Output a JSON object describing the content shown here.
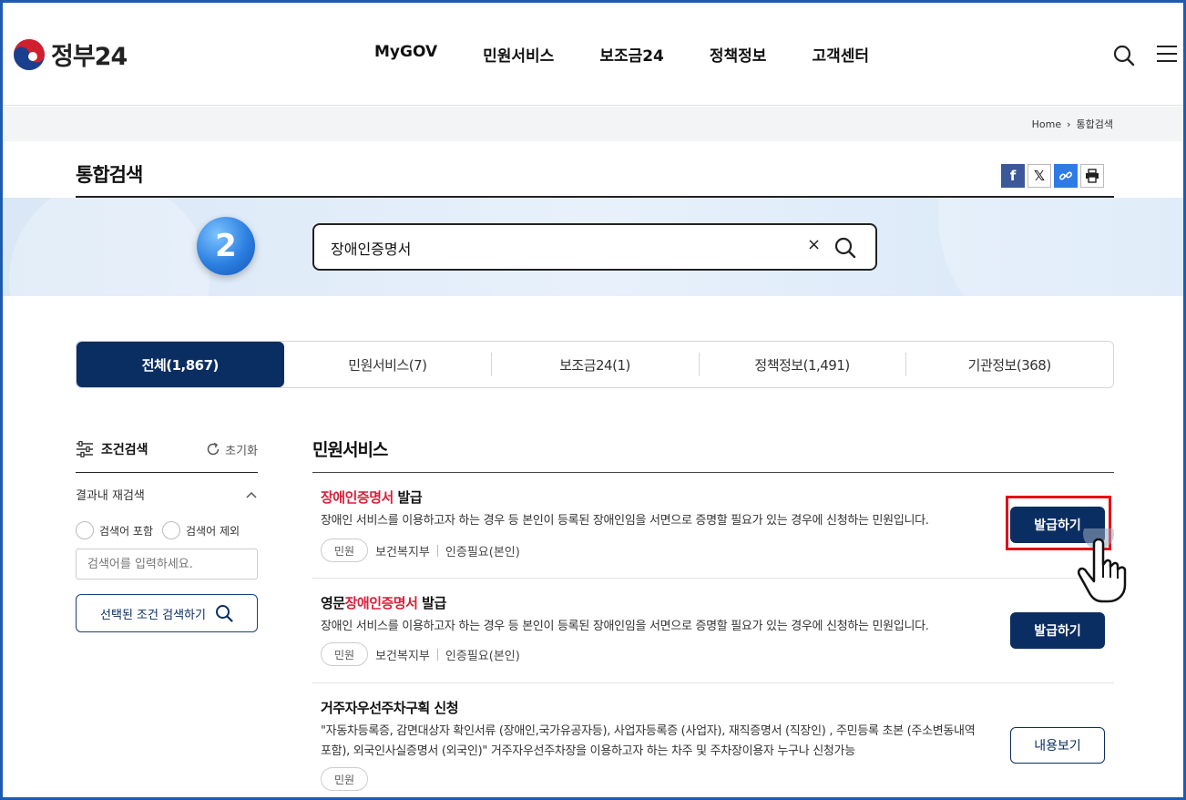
{
  "header": {
    "logo_text": "정부24",
    "nav": [
      "MyGOV",
      "민원서비스",
      "보조금24",
      "정책정보",
      "고객센터"
    ],
    "search_icon": "search-icon",
    "menu_icon": "hamburger-icon"
  },
  "breadcrumb": {
    "home": "Home",
    "current": "통합검색"
  },
  "page": {
    "title": "통합검색"
  },
  "search": {
    "step": "2",
    "value": "장애인증명서",
    "clear": "×"
  },
  "tabs": [
    {
      "label": "전체(1,867)",
      "active": true
    },
    {
      "label": "민원서비스(7)"
    },
    {
      "label": "보조금24(1)"
    },
    {
      "label": "정책정보(1,491)"
    },
    {
      "label": "기관정보(368)"
    }
  ],
  "sidebar": {
    "title": "조건검색",
    "reset": "초기화",
    "refine_title": "결과내 재검색",
    "include": "검색어 포함",
    "exclude": "검색어 제외",
    "placeholder": "검색어를 입력하세요.",
    "submit": "선택된 조건 검색하기"
  },
  "results_section": {
    "title": "민원서비스",
    "items": [
      {
        "title_prefix": "",
        "title_highlight": "장애인증명서",
        "title_suffix": " 발급",
        "desc": "장애인 서비스를 이용하고자 하는 경우 등 본인이 등록된 장애인임을 서면으로 증명할 필요가 있는 경우에 신청하는 민원입니다.",
        "tag": "민원",
        "agency": "보건복지부",
        "auth": "인증필요(본인)",
        "action": "발급하기"
      },
      {
        "title_prefix": "영문",
        "title_highlight": "장애인증명서",
        "title_suffix": " 발급",
        "desc": "장애인 서비스를 이용하고자 하는 경우 등 본인이 등록된 장애인임을 서면으로 증명할 필요가 있는 경우에 신청하는 민원입니다.",
        "tag": "민원",
        "agency": "보건복지부",
        "auth": "인증필요(본인)",
        "action": "발급하기"
      },
      {
        "title_prefix": "거주자우선주차구획 신청",
        "title_highlight": "",
        "title_suffix": "",
        "desc": "\"자동차등록증, 감면대상자 확인서류 (장애인,국가유공자등), 사업자등록증 (사업자), 재직증명서 (직장인) , 주민등록 초본 (주소변동내역 포함), 외국인사실증명서 (외국인)\" 거주자우선주차장을 이용하고자 하는 차주 및 주차장이용자 누구나 신청가능",
        "tag": "민원",
        "action": "내용보기"
      }
    ]
  },
  "colors": {
    "navy": "#0b2e62",
    "highlight": "#d81f3a",
    "annotation": "#e30d17"
  }
}
